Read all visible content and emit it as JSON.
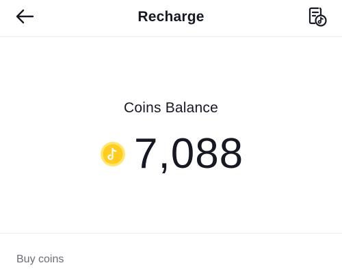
{
  "header": {
    "title": "Recharge",
    "back_icon": "arrow-left-icon",
    "history_icon": "transaction-history-icon"
  },
  "balance": {
    "label": "Coins Balance",
    "value": "7,088",
    "coin_icon": "coin-icon",
    "coin_color": "#FFD43B"
  },
  "buy": {
    "label": "Buy coins"
  },
  "colors": {
    "text": "#161823",
    "muted": "#6b6d75",
    "divider": "#eeeeee"
  }
}
